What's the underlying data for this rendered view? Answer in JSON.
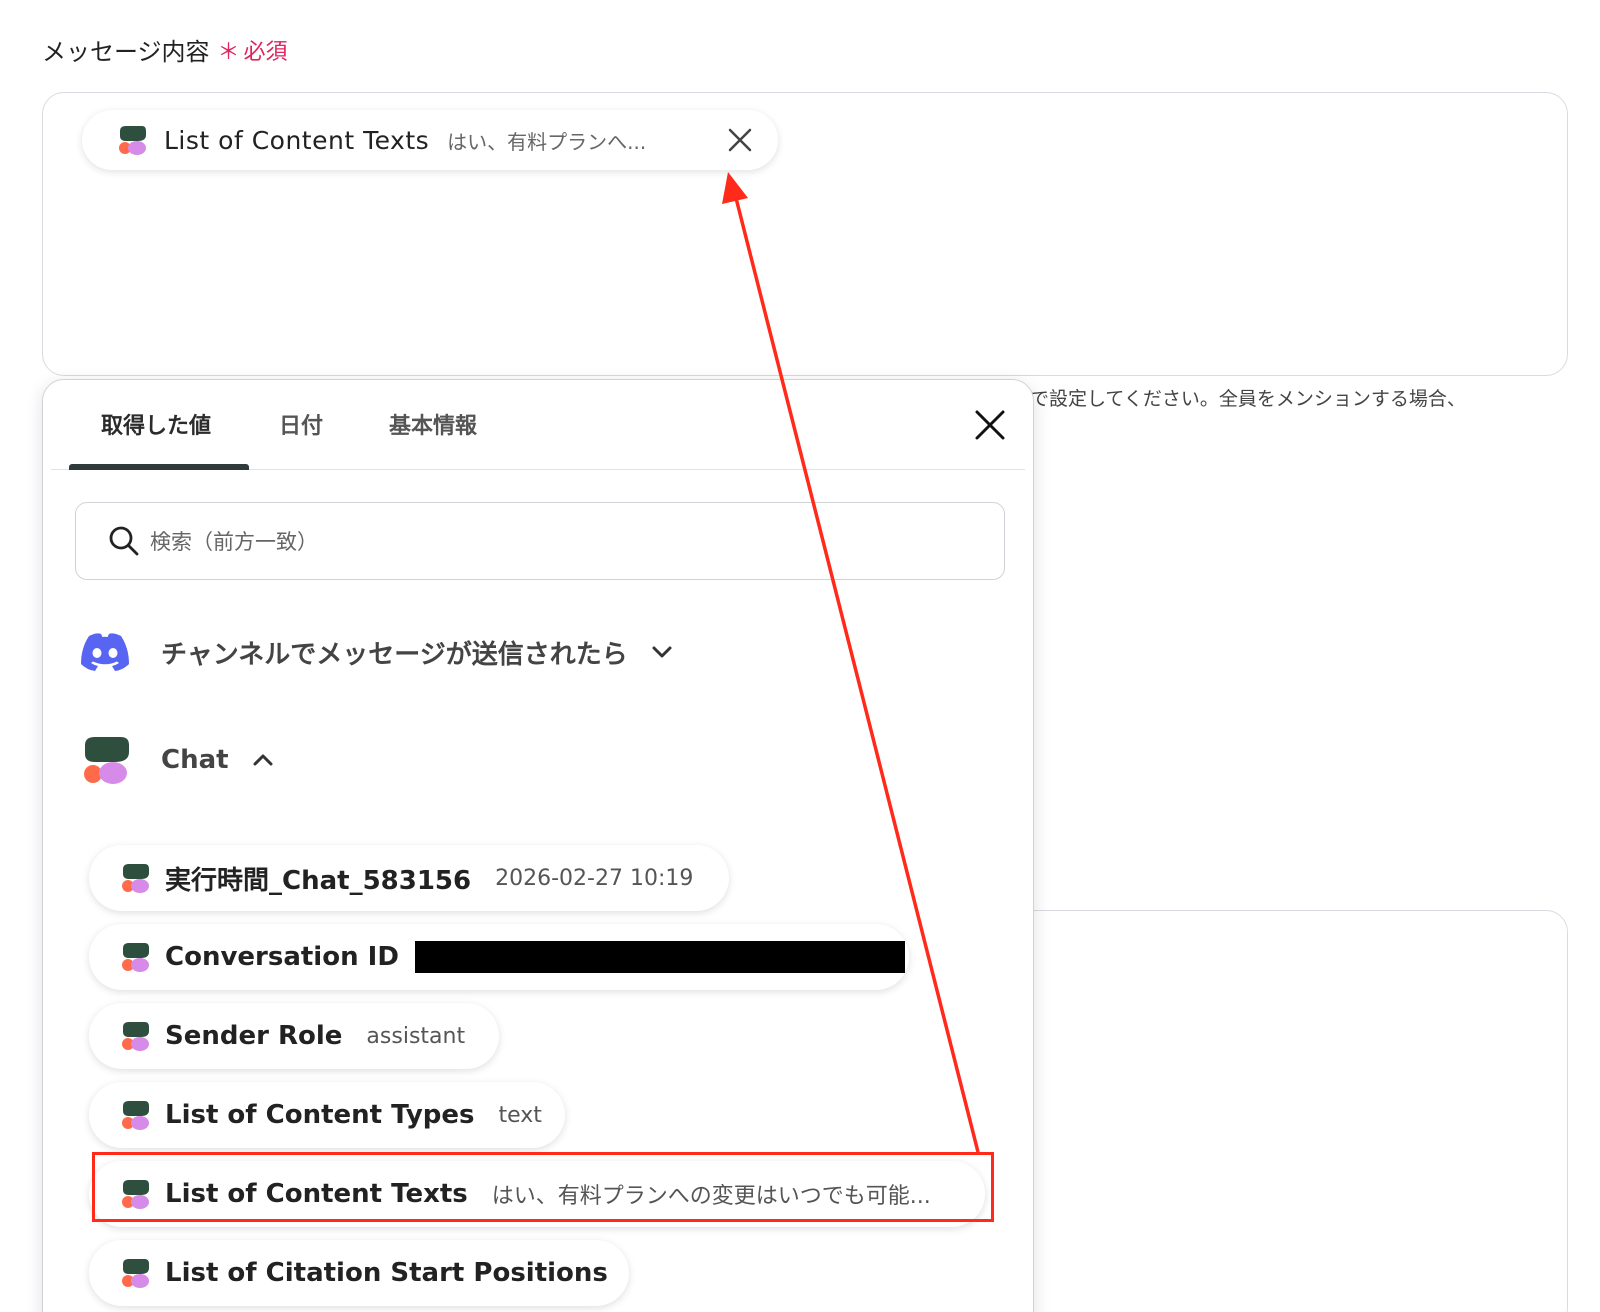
{
  "field": {
    "label": "メッセージ内容",
    "required_star": "＊",
    "required_text": "必須",
    "help_text": "で設定してください。全員をメンションする場合、"
  },
  "selected_chip": {
    "title": "List of Content Texts",
    "value": "はい、有料プランへ...",
    "close_icon": "close-icon"
  },
  "popup": {
    "tabs": [
      "取得した値",
      "日付",
      "基本情報"
    ],
    "active_tab": 0,
    "search_placeholder": "検索（前方一致）",
    "groups": [
      {
        "label": "チャンネルでメッセージが送信されたら",
        "icon": "discord-icon",
        "expanded": false
      },
      {
        "label": "Chat",
        "icon": "chat-app-icon",
        "expanded": true
      }
    ],
    "items": [
      {
        "name": "実行時間_Chat_583156",
        "value": "2026-02-27 10:19"
      },
      {
        "name": "Conversation ID",
        "value": "",
        "redacted": true
      },
      {
        "name": "Sender Role",
        "value": "assistant"
      },
      {
        "name": "List of Content Types",
        "value": "text"
      },
      {
        "name": "List of Content Texts",
        "value": "はい、有料プランへの変更はいつでも可能...",
        "highlighted": true
      },
      {
        "name": "List of Citation Start Positions",
        "value": ""
      }
    ]
  },
  "colors": {
    "accent_red": "#ff2a1a",
    "required_red": "#e0245e",
    "discord": "#5865f2",
    "app_dark_green": "#2f4f3e",
    "app_orange": "#ff6b4a",
    "app_purple": "#d78be8"
  }
}
